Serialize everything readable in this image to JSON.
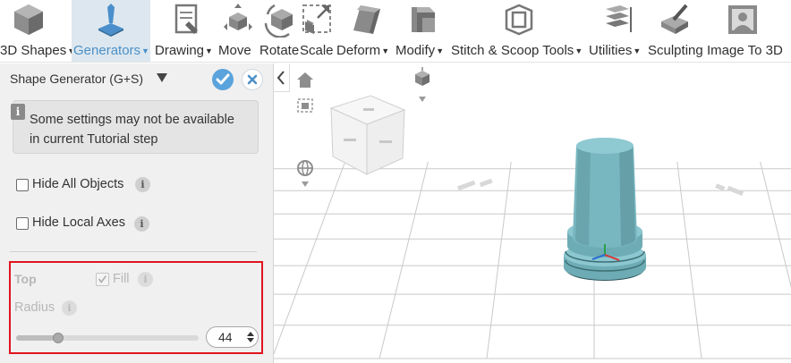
{
  "toolbar": {
    "items": [
      {
        "label": "3D Shapes",
        "icon": "cube-icon",
        "has_menu": true,
        "active": false
      },
      {
        "label": "Generators",
        "icon": "generator-pin-icon",
        "has_menu": true,
        "active": true
      },
      {
        "label": "Drawing",
        "icon": "drawing-icon",
        "has_menu": true,
        "active": false
      },
      {
        "label": "Move",
        "icon": "move-icon",
        "has_menu": false,
        "active": false
      },
      {
        "label": "Rotate",
        "icon": "rotate-icon",
        "has_menu": false,
        "active": false
      },
      {
        "label": "Scale",
        "icon": "scale-icon",
        "has_menu": false,
        "active": false
      },
      {
        "label": "Deform",
        "icon": "deform-icon",
        "has_menu": true,
        "active": false
      },
      {
        "label": "Modify",
        "icon": "modify-icon",
        "has_menu": true,
        "active": false
      },
      {
        "label": "Stitch & Scoop Tools",
        "icon": "stitch-scoop-icon",
        "has_menu": true,
        "active": false
      },
      {
        "label": "Utilities",
        "icon": "utilities-icon",
        "has_menu": true,
        "active": false
      },
      {
        "label": "Sculpting",
        "icon": "sculpting-icon",
        "has_menu": false,
        "active": false
      },
      {
        "label": "Image To 3D",
        "icon": "image-to-3d-icon",
        "has_menu": false,
        "active": false
      }
    ]
  },
  "panel": {
    "title": "Shape Generator (G+S)",
    "info_text": "Some settings may not be available in current Tutorial step",
    "hide_all_objects": {
      "label": "Hide All Objects",
      "checked": false
    },
    "hide_local_axes": {
      "label": "Hide Local Axes",
      "checked": false
    },
    "top_section": {
      "title": "Top",
      "fill_label": "Fill",
      "fill_checked": true,
      "radius_label": "Radius",
      "radius_value": "44",
      "slider_fraction": 0.23
    }
  },
  "colors": {
    "accent": "#5aa3dc",
    "active_tab_bg": "#dde7ef",
    "highlight_border": "#e0141e",
    "shape_fill": "#7fbcc5"
  }
}
